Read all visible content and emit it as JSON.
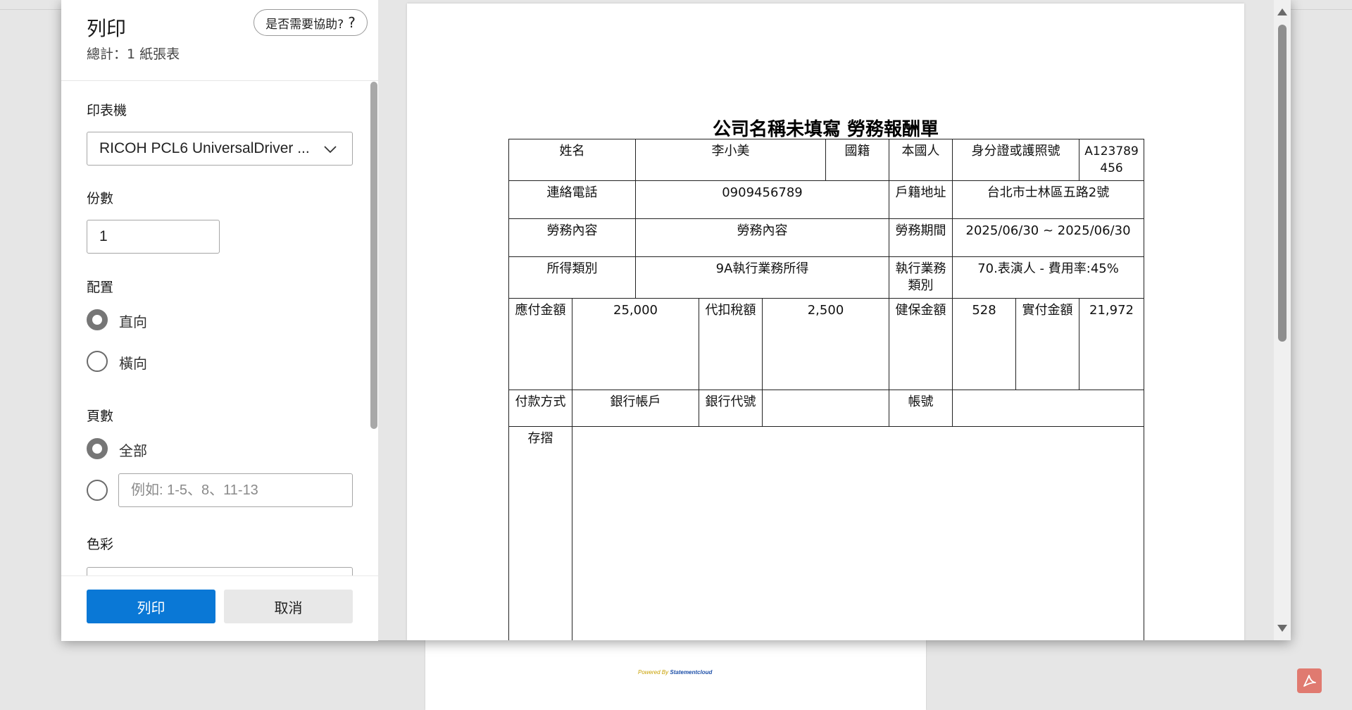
{
  "dialog": {
    "title": "列印",
    "subtitle": "總計：1 紙張表",
    "help_label": "是否需要協助?",
    "help_icon": "?"
  },
  "printer": {
    "label": "印表機",
    "selected": "RICOH PCL6 UniversalDriver ..."
  },
  "copies": {
    "label": "份數",
    "value": "1"
  },
  "layout": {
    "label": "配置",
    "options": [
      "直向",
      "橫向"
    ],
    "selected": "直向"
  },
  "pages": {
    "label": "頁數",
    "all_label": "全部",
    "range_placeholder": "例如: 1-5、8、11-13",
    "selected": "全部"
  },
  "color": {
    "label": "色彩"
  },
  "buttons": {
    "print": "列印",
    "cancel": "取消"
  },
  "document": {
    "title": "公司名稱未填寫 勞務報酬單",
    "rows": {
      "name_label": "姓名",
      "name": "李小美",
      "nationality_label": "國籍",
      "nationality": "本國人",
      "id_label": "身分證或護照號",
      "id": "A123789456",
      "phone_label": "連絡電話",
      "phone": "0909456789",
      "address_label": "戶籍地址",
      "address": "台北市士林區五路2號",
      "content_label": "勞務內容",
      "content": "勞務內容",
      "period_label": "勞務期間",
      "period": "2025/06/30 ~ 2025/06/30",
      "income_type_label": "所得類別",
      "income_type": "9A執行業務所得",
      "business_type_label": "執行業務類別",
      "business_type": "70.表演人 - 費用率:45%",
      "payable_label": "應付金額",
      "payable": "25,000",
      "withholding_label": "代扣稅額",
      "withholding": "2,500",
      "health_label": "健保金額",
      "health": "528",
      "net_label": "實付金額",
      "net": "21,972",
      "payment_method_label": "付款方式",
      "payment_method": "銀行帳戶",
      "bank_code_label": "銀行代號",
      "bank_code": "",
      "account_label": "帳號",
      "account": "",
      "stub_label": "存摺"
    }
  },
  "background": {
    "powered_prefix": "Powered By",
    "powered_brand": "Statementcloud"
  },
  "icons": {
    "pdf": "pdf-icon",
    "chevron": "chevron-down-icon"
  },
  "colors": {
    "primary": "#0a78d6",
    "pdf_badge": "#e07a70"
  }
}
